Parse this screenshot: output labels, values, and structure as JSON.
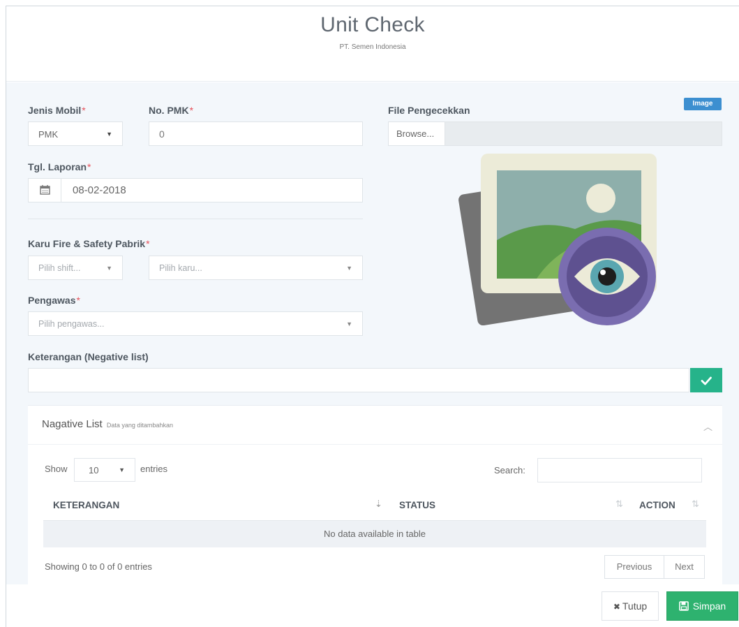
{
  "header": {
    "title": "Unit Check",
    "subtitle": "PT. Semen Indonesia"
  },
  "form": {
    "jenis_mobil": {
      "label": "Jenis Mobil",
      "required_mark": "*",
      "value": "PMK"
    },
    "no_pmk": {
      "label": "No. PMK",
      "required_mark": "*",
      "value": "0"
    },
    "tgl_laporan": {
      "label": "Tgl. Laporan",
      "required_mark": "*",
      "value": "08-02-2018",
      "icon": "calendar-icon"
    },
    "karu": {
      "label": "Karu Fire & Safety Pabrik",
      "required_mark": "*",
      "shift_placeholder": "Pilih shift...",
      "karu_placeholder": "Pilih karu..."
    },
    "pengawas": {
      "label": "Pengawas",
      "required_mark": "*",
      "placeholder": "Pilih pengawas..."
    },
    "file": {
      "label": "File Pengecekkan",
      "badge": "Image",
      "browse_label": "Browse...",
      "preview_icon": "image-preview-eye-icon"
    },
    "keterangan": {
      "label": "Keterangan (Negative list)",
      "value": "",
      "submit_icon": "check-icon"
    }
  },
  "negative_list": {
    "title": "Nagative List",
    "subtitle": "Data yang ditambahkan",
    "show_label": "Show",
    "entries_label": "entries",
    "page_length": "10",
    "search_label": "Search:",
    "columns": [
      "KETERANGAN",
      "STATUS",
      "ACTION"
    ],
    "rows": [],
    "empty_text": "No data available in table",
    "info": "Showing 0 to 0 of 0 entries",
    "previous_label": "Previous",
    "next_label": "Next"
  },
  "footer": {
    "close_label": "Tutup",
    "save_label": "Simpan"
  },
  "colors": {
    "badge": "#3c8fd0",
    "submit_green": "#26b38a",
    "save_green": "#2eb26f",
    "required": "#e7505a",
    "form_background": "#f3f7fb"
  }
}
